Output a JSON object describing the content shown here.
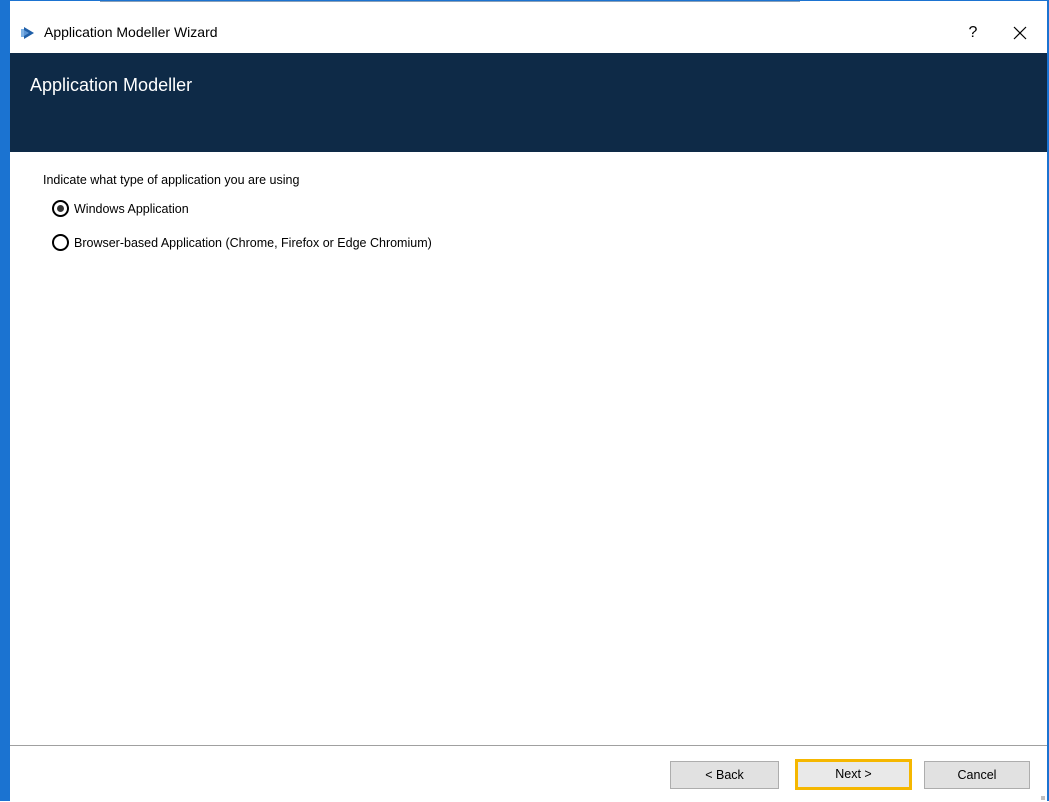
{
  "window": {
    "title": "Application Modeller Wizard",
    "help_label": "?",
    "close_glyph": "close-icon",
    "accent_border_color": "#1b73d1",
    "header_color": "#0e2a47",
    "focus_color": "#f5b700"
  },
  "header": {
    "title": "Application Modeller"
  },
  "content": {
    "prompt": "Indicate what type of application you are using",
    "options": [
      {
        "label": "Windows Application",
        "selected": true
      },
      {
        "label": "Browser-based Application (Chrome, Firefox or Edge Chromium)",
        "selected": false
      }
    ]
  },
  "footer": {
    "back_label": "< Back",
    "next_label": "Next >",
    "cancel_label": "Cancel"
  }
}
